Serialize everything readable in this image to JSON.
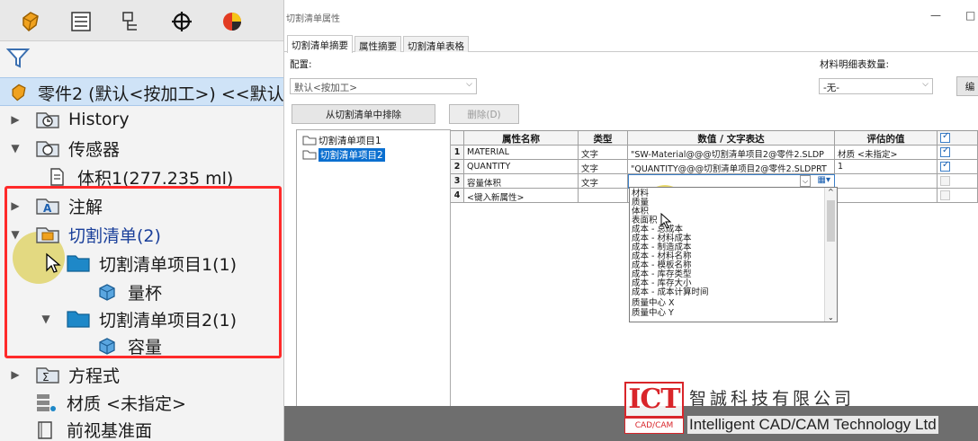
{
  "feature_tree": {
    "root": "零件2 (默认<按加工>) <<默认>_",
    "items": {
      "history": "History",
      "sensors": "传感器",
      "volume": "体积1(277.235 ml)",
      "annotations": "注解",
      "cutlist": "切割清单(2)",
      "cutitem1": "切割清单项目1(1)",
      "body1": "量杯",
      "cutitem2": "切割清单项目2(1)",
      "body2": "容量",
      "equations": "方程式",
      "material": "材质 <未指定>",
      "front_plane": "前视基准面"
    }
  },
  "dialog": {
    "title": "切割清单属性",
    "win_min": "—",
    "win_max": "□",
    "tabs": [
      "切割清单摘要",
      "属性摘要",
      "切割清单表格"
    ],
    "config_label": "配置:",
    "config_value": "默认<按加工>",
    "bom_label": "材料明细表数量:",
    "bom_value": "-无-",
    "edit_label": "编",
    "exclude_button": "从切割清单中排除",
    "delete_button": "删除(D)",
    "list_items": [
      "切割清单项目1",
      "切割清单项目2"
    ],
    "columns": [
      "属性名称",
      "类型",
      "数值 / 文字表达",
      "评估的值"
    ],
    "rows": [
      {
        "num": "1",
        "name": "MATERIAL",
        "type": "文字",
        "value": "\"SW-Material@@@切割清单项目2@零件2.SLDP",
        "eval": "材质 <未指定>",
        "check": true
      },
      {
        "num": "2",
        "name": "QUANTITY",
        "type": "文字",
        "value": "\"QUANTITY@@@切割清单项目2@零件2.SLDPRT",
        "eval": "1",
        "check": true
      },
      {
        "num": "3",
        "name": "容量体积",
        "type": "文字",
        "value": "",
        "eval": "",
        "check": false
      },
      {
        "num": "4",
        "name": "<键入新属性>",
        "type": "",
        "value": "",
        "eval": "",
        "check": false
      }
    ],
    "dropdown_options": [
      "材料",
      "质量",
      "体积",
      "表面积",
      "成本 - 总成本",
      "成本 - 材料成本",
      "成本 - 制造成本",
      "成本 - 材料名称",
      "成本 - 模板名称",
      "成本 - 库存类型",
      "成本 - 库存大小",
      "成本 - 成本计算时间",
      "质量中心 X",
      "质量中心 Y"
    ]
  },
  "watermark": {
    "logo": "ICT",
    "sub": "CAD/CAM",
    "company_cn": "智誠科技有限公司",
    "company_en": "Intelligent CAD/CAM Technology Ltd"
  }
}
